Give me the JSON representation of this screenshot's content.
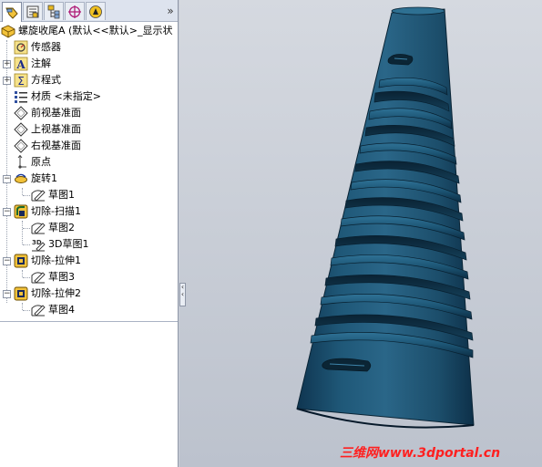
{
  "feature_tree": {
    "tabs": [
      {
        "name": "feature-manager-tab"
      },
      {
        "name": "property-manager-tab"
      },
      {
        "name": "configuration-manager-tab"
      },
      {
        "name": "dimxpert-manager-tab"
      },
      {
        "name": "display-manager-tab"
      }
    ],
    "more_tabs_label": "»",
    "root": {
      "label": "螺旋收尾A  (默认<<默认>_显示状",
      "icon": "part-icon"
    },
    "items": [
      {
        "label": "传感器",
        "icon": "sensor-icon"
      },
      {
        "label": "注解",
        "icon": "annotation-icon"
      },
      {
        "label": "方程式",
        "icon": "equation-icon"
      },
      {
        "label": "材质 <未指定>",
        "icon": "material-icon"
      },
      {
        "label": "前视基准面",
        "icon": "plane-icon"
      },
      {
        "label": "上视基准面",
        "icon": "plane-icon"
      },
      {
        "label": "右视基准面",
        "icon": "plane-icon"
      },
      {
        "label": "原点",
        "icon": "origin-icon"
      },
      {
        "label": "旋转1",
        "icon": "revolve-icon"
      },
      {
        "label": "草图1",
        "icon": "sketch-icon"
      },
      {
        "label": "切除-扫描1",
        "icon": "cut-sweep-icon"
      },
      {
        "label": "草图2",
        "icon": "sketch-icon"
      },
      {
        "label": "3D草图1",
        "icon": "3d-sketch-icon"
      },
      {
        "label": "切除-拉伸1",
        "icon": "cut-extrude-icon"
      },
      {
        "label": "草图3",
        "icon": "sketch-icon"
      },
      {
        "label": "切除-拉伸2",
        "icon": "cut-extrude-icon"
      },
      {
        "label": "草图4",
        "icon": "sketch-icon"
      }
    ]
  },
  "graphics": {
    "model": "tapered-threaded-cone",
    "body_color": "#1f5470"
  },
  "watermark": "三维网www.3dportal.cn"
}
